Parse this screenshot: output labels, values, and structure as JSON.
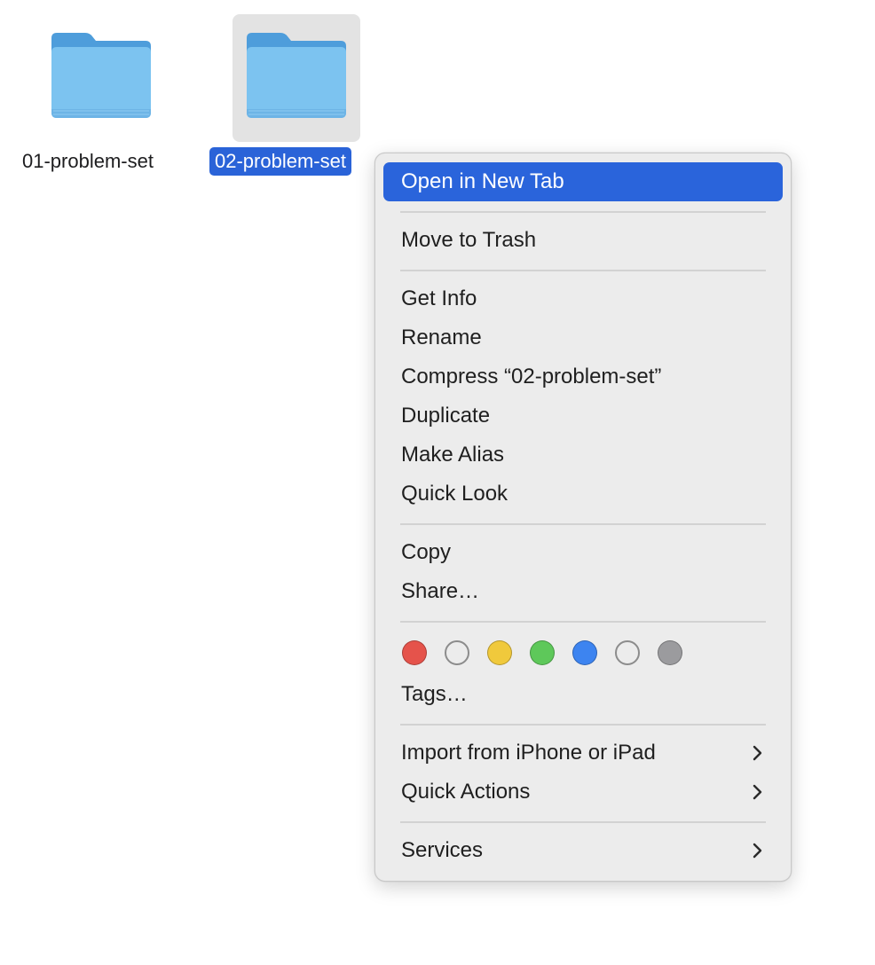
{
  "folders": [
    {
      "name": "01-problem-set",
      "selected": false
    },
    {
      "name": "02-problem-set",
      "selected": true
    }
  ],
  "menu": {
    "open_in_new_tab": "Open in New Tab",
    "move_to_trash": "Move to Trash",
    "get_info": "Get Info",
    "rename": "Rename",
    "compress": "Compress “02-problem-set”",
    "duplicate": "Duplicate",
    "make_alias": "Make Alias",
    "quick_look": "Quick Look",
    "copy": "Copy",
    "share": "Share…",
    "tags": "Tags…",
    "import_from_iphone": "Import from iPhone or iPad",
    "quick_actions": "Quick Actions",
    "services": "Services"
  },
  "tag_colors": [
    {
      "name": "red",
      "color": "#e5534b"
    },
    {
      "name": "orange",
      "color": "hollow"
    },
    {
      "name": "yellow",
      "color": "#f0c93c"
    },
    {
      "name": "green",
      "color": "#5ec85a"
    },
    {
      "name": "blue",
      "color": "#3d84f0"
    },
    {
      "name": "purple",
      "color": "hollow"
    },
    {
      "name": "gray",
      "color": "#9b9b9e"
    }
  ],
  "colors": {
    "highlight": "#2a64db",
    "folder_blue": "#7cc3f0",
    "folder_tab": "#4e9ddb"
  }
}
